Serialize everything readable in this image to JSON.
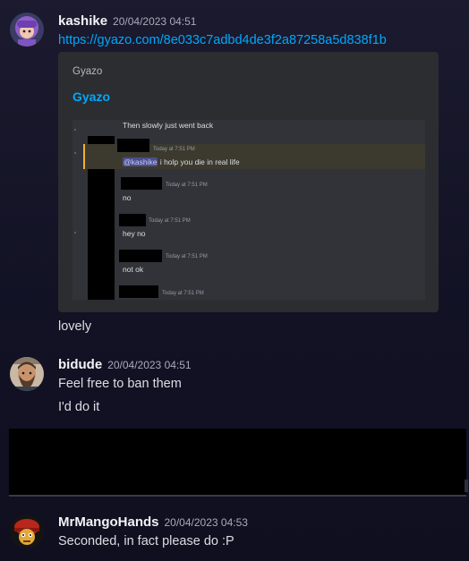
{
  "messages": [
    {
      "author": "kashike",
      "timestamp": "20/04/2023 04:51",
      "link": "https://gyazo.com/8e033c7adbd4de3f2a87258a5d838f1b",
      "embed": {
        "provider": "Gyazo",
        "title": "Gyazo",
        "screenshot": {
          "lines": {
            "l1": "Then slowly just went back",
            "mention": "@kashike",
            "l2_rest": " i holp you die in real life",
            "l3": "no",
            "l4": "hey no",
            "l5": "not ok"
          },
          "timestamps": {
            "t1": "Today at 7:51 PM",
            "t2": "Today at 7:51 PM",
            "t3": "Today at 7:51 PM",
            "t4": "Today at 7:51 PM",
            "t5": "Today at 7:51 PM"
          }
        }
      },
      "text": "lovely"
    },
    {
      "author": "bidude",
      "timestamp": "20/04/2023 04:51",
      "lines": [
        "Feel free to ban them",
        "I'd do it"
      ]
    },
    {
      "author": "MrMangoHands",
      "timestamp": "20/04/2023 04:53",
      "lines": [
        "Seconded, in fact please do :P"
      ]
    }
  ],
  "icons": {
    "avatar1": "avatar-purple-character",
    "avatar2": "avatar-bearded-man",
    "avatar3": "avatar-red-hat-character"
  },
  "colors": {
    "link": "#00a8fc",
    "username": "#f2f3f5",
    "timestamp": "#a9aab8",
    "embed_bg": "#2b2d31",
    "highlight_bar": "#f0b232"
  }
}
